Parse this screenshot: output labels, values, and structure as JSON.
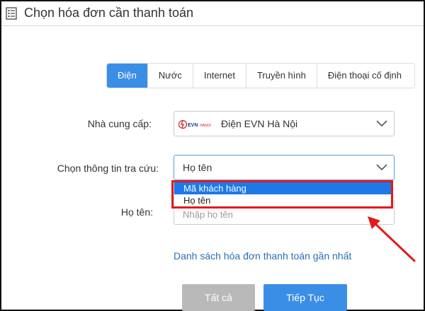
{
  "header": {
    "title": "Chọn hóa đơn cần thanh toán",
    "icon": "list-icon"
  },
  "tabs": [
    {
      "label": "Điện",
      "active": true
    },
    {
      "label": "Nước",
      "active": false
    },
    {
      "label": "Internet",
      "active": false
    },
    {
      "label": "Truyền hình",
      "active": false
    },
    {
      "label": "Điện thoại cố định",
      "active": false
    }
  ],
  "form": {
    "provider": {
      "label": "Nhà cung cấp:",
      "value": "Điện EVN Hà Nội",
      "logo_text": "EVNHANOI"
    },
    "lookup": {
      "label": "Chọn thông tin tra cứu:",
      "value": "Họ tên",
      "options": [
        "Mã khách hàng",
        "Họ tên"
      ],
      "highlighted_option": "Mã khách hàng"
    },
    "name": {
      "label": "Họ tên:",
      "placeholder": "Nhập họ tên",
      "value": ""
    }
  },
  "recent_link": "Danh sách hóa đơn thanh toán gần nhất",
  "buttons": {
    "all": "Tất cả",
    "continue": "Tiếp Tục"
  },
  "colors": {
    "accent": "#3b8ee6",
    "highlight": "#1e78e8",
    "annotation": "#e31b1b",
    "disabled_button": "#b9b9b9",
    "link": "#2a6fb5"
  }
}
